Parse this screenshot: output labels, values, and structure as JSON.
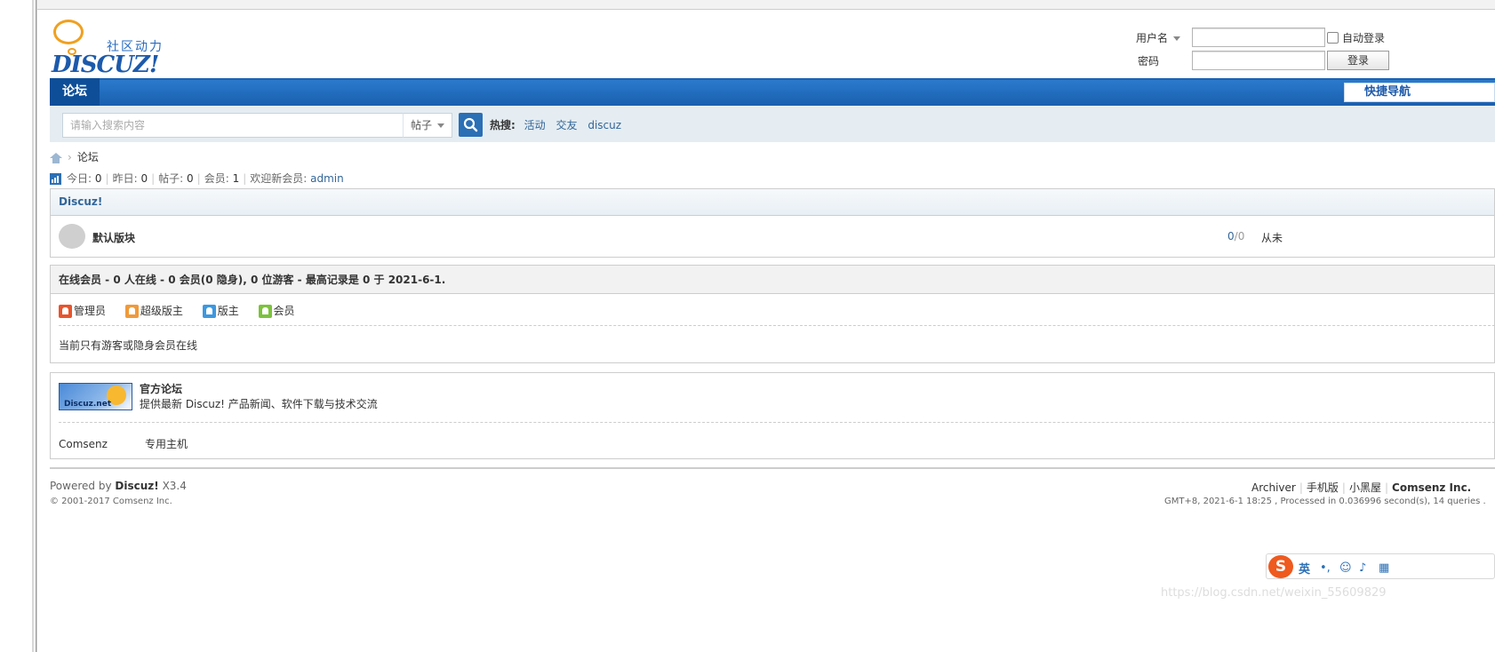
{
  "header": {
    "brand_tag": "社区动力",
    "brand_name": "DISCUZ!",
    "login": {
      "username_label": "用户名",
      "password_label": "密码",
      "auto_login": "自动登录",
      "login_button": "登录"
    }
  },
  "nav": {
    "tab": "论坛",
    "quick": "快捷导航"
  },
  "search": {
    "placeholder": "请输入搜索内容",
    "scope": "帖子",
    "hot_label": "热搜:",
    "hot_terms": [
      "活动",
      "交友",
      "discuz"
    ]
  },
  "breadcrumb": {
    "current": "论坛"
  },
  "stats": {
    "today_label": "今日:",
    "today": "0",
    "yesterday_label": "昨日:",
    "yesterday": "0",
    "posts_label": "帖子:",
    "posts": "0",
    "members_label": "会员:",
    "members": "1",
    "welcome_label": "欢迎新会员:",
    "welcome_user": "admin"
  },
  "category": {
    "title": "Discuz!",
    "forum": {
      "name": "默认版块",
      "threads": "0",
      "slash": "/",
      "posts": "0",
      "last_post": "从未"
    }
  },
  "online": {
    "title": "在线会员 - 0 人在线 - 0 会员(0 隐身), 0 位游客 - 最高记录是 0 于 2021-6-1.",
    "roles": [
      {
        "label": "管理员",
        "color": "#e8542c"
      },
      {
        "label": "超级版主",
        "color": "#f09a3a"
      },
      {
        "label": "版主",
        "color": "#3c98e0"
      },
      {
        "label": "会员",
        "color": "#7cc23c"
      }
    ],
    "note": "当前只有游客或隐身会员在线"
  },
  "links": {
    "logo_text": "Discuz.net",
    "title": "官方论坛",
    "desc": "提供最新 Discuz! 产品新闻、软件下载与技术交流",
    "text_links": [
      "Comsenz",
      "专用主机"
    ]
  },
  "footer": {
    "powered_prefix": "Powered by",
    "powered_name": "Discuz!",
    "version": "X3.4",
    "copyright": "© 2001-2017 Comsenz Inc.",
    "links": [
      "Archiver",
      "手机版",
      "小黑屋",
      "Comsenz Inc."
    ],
    "time": "GMT+8, 2021-6-1 18:25 , Processed in 0.036996 second(s), 14 queries ."
  },
  "ime": {
    "logo": "S",
    "mode": "英"
  },
  "watermark": "https://blog.csdn.net/weixin_55609829"
}
